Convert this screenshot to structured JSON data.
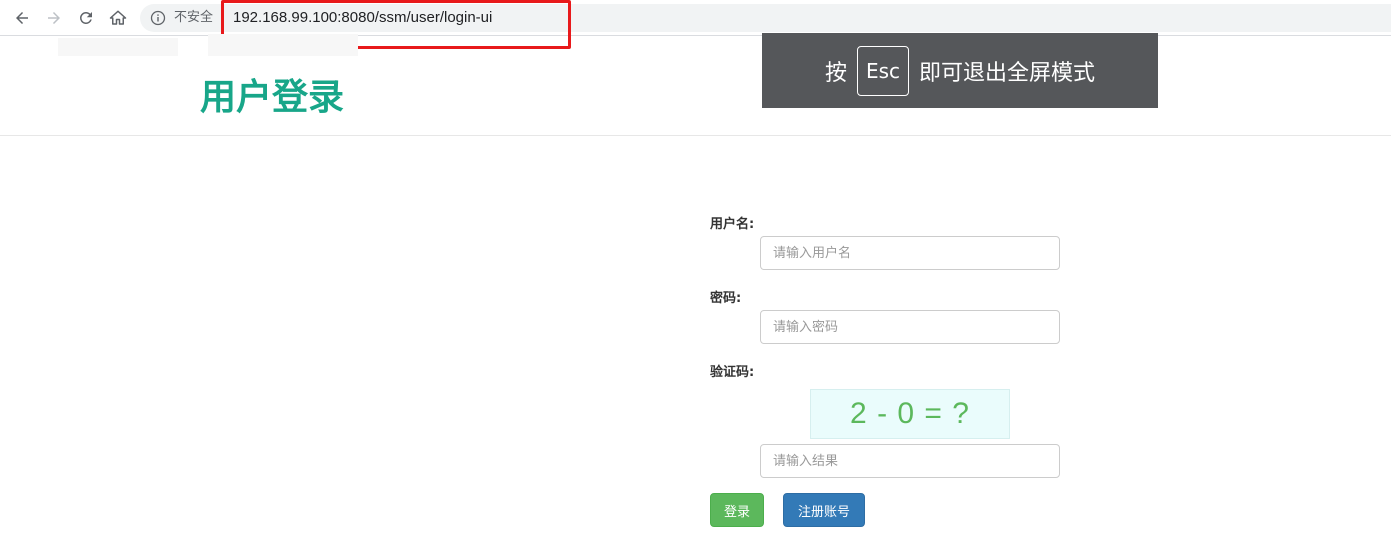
{
  "browser": {
    "security_label": "不安全",
    "url": "192.168.99.100:8080/ssm/user/login-ui"
  },
  "header": {
    "title": "用户登录"
  },
  "fullscreen_toast": {
    "before": "按",
    "key": "Esc",
    "after": "即可退出全屏模式"
  },
  "form": {
    "username_label": "用户名:",
    "username_placeholder": "请输入用户名",
    "password_label": "密码:",
    "password_placeholder": "请输入密码",
    "captcha_label": "验证码:",
    "captcha_question": "2 - 0 = ?",
    "captcha_placeholder": "请输入结果",
    "login_button": "登录",
    "register_button": "注册账号"
  },
  "colors": {
    "title": "#18a689",
    "login_button": "#5cb85c",
    "register_button": "#337ab7",
    "highlight": "#e8191b"
  }
}
